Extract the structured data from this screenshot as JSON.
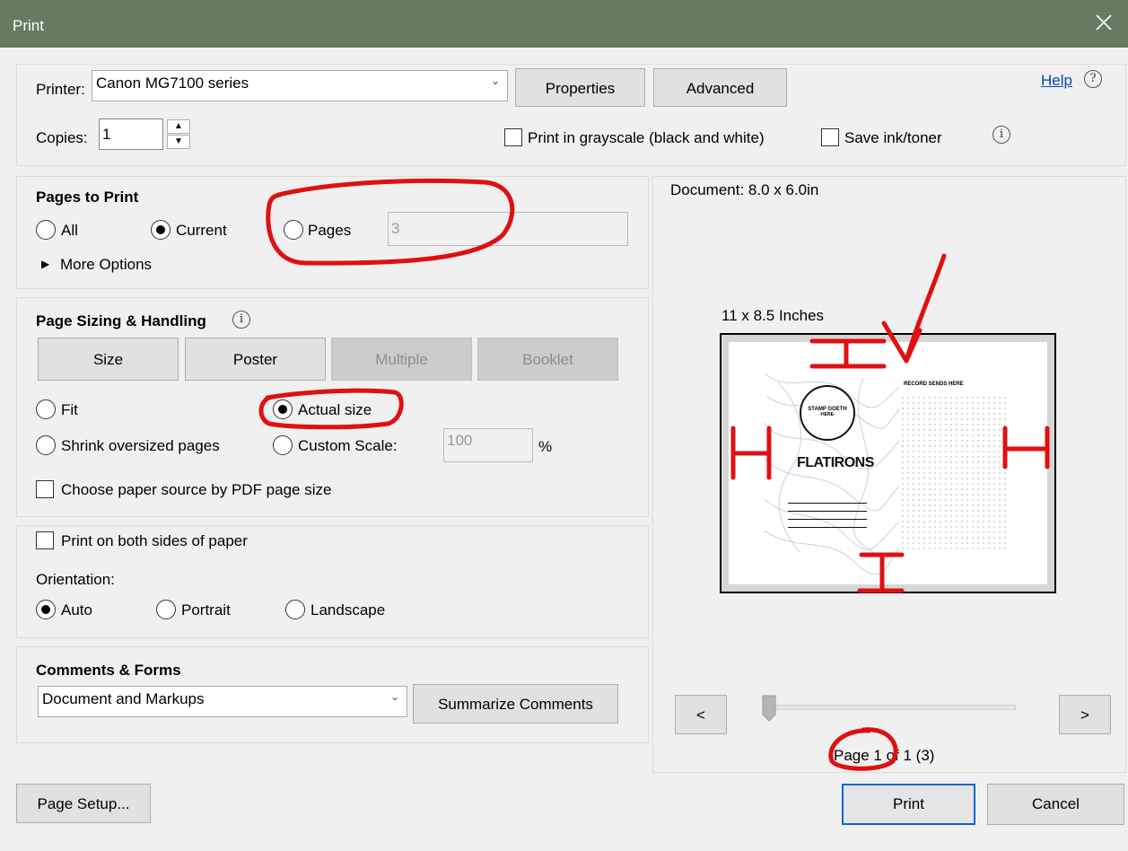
{
  "window": {
    "title": "Print",
    "close_icon": "close-icon"
  },
  "header": {
    "printer_label": "Printer:",
    "printer_value": "Canon MG7100 series",
    "properties_label": "Properties",
    "advanced_label": "Advanced",
    "help_label": "Help",
    "copies_label": "Copies:",
    "copies_value": "1",
    "grayscale_label": "Print in grayscale (black and white)",
    "grayscale_checked": false,
    "save_ink_label": "Save ink/toner",
    "save_ink_checked": false
  },
  "pages_to_print": {
    "heading": "Pages to Print",
    "all_label": "All",
    "current_label": "Current",
    "pages_label": "Pages",
    "pages_value": "3",
    "selected": "current",
    "more_options_label": "More Options"
  },
  "page_sizing": {
    "heading": "Page Sizing & Handling",
    "tabs": [
      "Size",
      "Poster",
      "Multiple",
      "Booklet"
    ],
    "fit_label": "Fit",
    "actual_size_label": "Actual size",
    "shrink_label": "Shrink oversized pages",
    "custom_scale_label": "Custom Scale:",
    "custom_scale_value": "100",
    "percent_label": "%",
    "selected": "actual_size",
    "paper_source_label": "Choose paper source by PDF page size"
  },
  "duplex": {
    "both_sides_label": "Print on both sides of paper",
    "orientation_label": "Orientation:",
    "auto_label": "Auto",
    "portrait_label": "Portrait",
    "landscape_label": "Landscape",
    "selected": "auto"
  },
  "comments_forms": {
    "heading": "Comments & Forms",
    "value": "Document and Markups",
    "summarize_label": "Summarize Comments"
  },
  "preview": {
    "document_size": "Document: 8.0 x 6.0in",
    "paper_size": "11 x 8.5 Inches",
    "prev_label": "<",
    "next_label": ">",
    "page_indicator": "Page 1 of 1 (3)",
    "slider_position": 0,
    "thumb_stamp_line1": "STAMP GOETH",
    "thumb_stamp_line2": "-HERE-",
    "thumb_title": "FLATIRONS",
    "thumb_record": "RECORD SENDS HERE"
  },
  "footer": {
    "page_setup_label": "Page Setup...",
    "print_label": "Print",
    "cancel_label": "Cancel"
  },
  "colors": {
    "titlebar": "#667c61",
    "annotation": "#e01010",
    "primary_border": "#0a64d2"
  }
}
